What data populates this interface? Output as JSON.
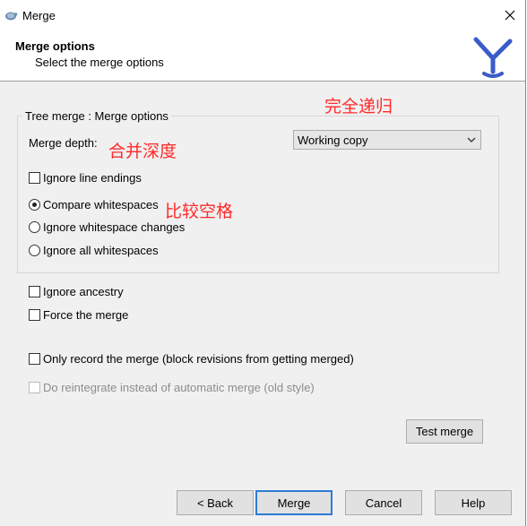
{
  "window": {
    "title": "Merge"
  },
  "header": {
    "title": "Merge options",
    "subtitle": "Select the merge options"
  },
  "group": {
    "legend": "Tree merge : Merge options"
  },
  "merge_depth": {
    "label": "Merge depth:",
    "selected": "Working copy"
  },
  "options": {
    "ignore_line_endings": {
      "label": "Ignore line endings",
      "checked": false
    },
    "whitespace": [
      {
        "label": "Compare whitespaces",
        "checked": true
      },
      {
        "label": "Ignore whitespace changes",
        "checked": false
      },
      {
        "label": "Ignore all whitespaces",
        "checked": false
      }
    ],
    "ignore_ancestry": {
      "label": "Ignore ancestry",
      "checked": false
    },
    "force_merge": {
      "label": "Force the merge",
      "checked": false
    },
    "record_only": {
      "label": "Only record the merge (block revisions from getting merged)",
      "checked": false
    },
    "reintegrate": {
      "label": "Do reintegrate instead of automatic merge (old style)",
      "checked": false,
      "enabled": false
    }
  },
  "annotations": {
    "full_recursion": "完全递归",
    "merge_depth": "合并深度",
    "compare_spaces": "比较空格"
  },
  "buttons": {
    "test_merge": "Test merge",
    "back": "< Back",
    "merge": "Merge",
    "cancel": "Cancel",
    "help": "Help"
  },
  "colors": {
    "annotation": "#ff2a2a",
    "default_button_border": "#2f7bd4",
    "logo": "#3a5bc9"
  }
}
